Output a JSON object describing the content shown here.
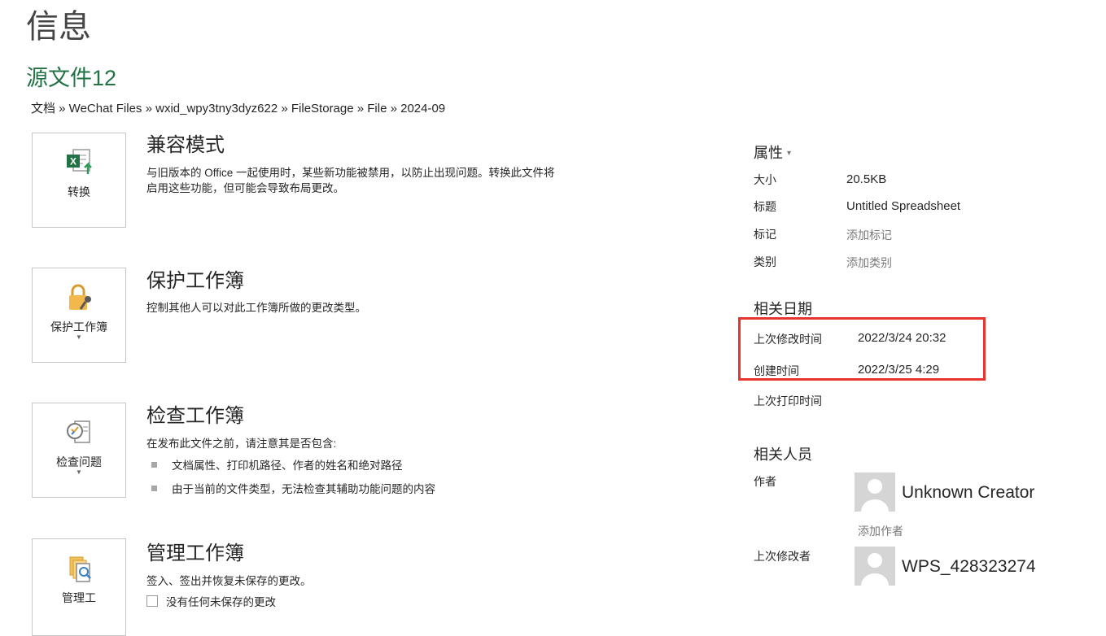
{
  "page": {
    "title": "信息"
  },
  "document": {
    "name": "源文件12",
    "breadcrumb": "文档 » WeChat Files » wxid_wpy3tny3dyz622 » FileStorage » File » 2024-09"
  },
  "sections": {
    "compat": {
      "button_label": "转换",
      "title": "兼容模式",
      "desc_line1": "与旧版本的 Office 一起使用时，某些新功能被禁用，以防止出现问题。转换此文件将",
      "desc_line2": "启用这些功能，但可能会导致布局更改。"
    },
    "protect": {
      "button_label": "保护工作簿",
      "title": "保护工作簿",
      "desc": "控制其他人可以对此工作簿所做的更改类型。"
    },
    "inspect": {
      "button_label": "检查问题",
      "title": "检查工作簿",
      "desc": "在发布此文件之前，请注意其是否包含:",
      "bullets": [
        "文档属性、打印机路径、作者的姓名和绝对路径",
        "由于当前的文件类型，无法检查其辅助功能问题的内容"
      ]
    },
    "manage": {
      "button_label": "管理工",
      "title": "管理工作簿",
      "desc": "签入、签出并恢复未保存的更改。",
      "sub": "没有任何未保存的更改"
    }
  },
  "properties": {
    "header": "属性",
    "header_caret": "▾",
    "size_label": "大小",
    "size_value": "20.5KB",
    "title_label": "标题",
    "title_value": "Untitled Spreadsheet",
    "tags_label": "标记",
    "tags_value": "添加标记",
    "category_label": "类别",
    "category_value": "添加类别"
  },
  "dates": {
    "header": "相关日期",
    "modified_label": "上次修改时间",
    "modified_value": "2022/3/24 20:32",
    "created_label": "创建时间",
    "created_value": "2022/3/25 4:29",
    "printed_label": "上次打印时间"
  },
  "people": {
    "header": "相关人员",
    "author_label": "作者",
    "author_name": "Unknown Creator",
    "add_author": "添加作者",
    "last_modified_by_label": "上次修改者",
    "last_modified_by_name": "WPS_428323274"
  },
  "colors": {
    "accent": "#217346",
    "highlight": "#e8332f"
  }
}
